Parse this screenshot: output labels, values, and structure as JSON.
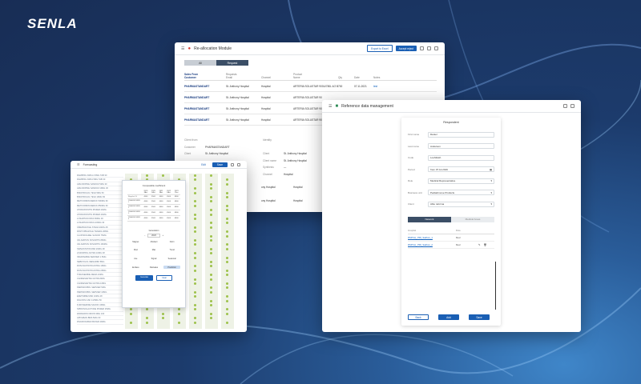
{
  "brand": {
    "logo": "SENLA"
  },
  "w1": {
    "title": "Re-allocation Module",
    "buttons": {
      "export": "Export to Excel",
      "accept": "Accept reject"
    },
    "tabs": [
      "All",
      "Request"
    ],
    "headers_top": [
      "Sales From",
      "Requests",
      "",
      "Product",
      "",
      "",
      ""
    ],
    "headers": [
      "Customer",
      "Email",
      "Channel",
      "Name",
      "Qty",
      "Date",
      "Notes"
    ],
    "rows": [
      [
        "PHARMASTANDART",
        "St. Anthony Hospital",
        "Hospital",
        "ARTERIA SOLUSTAR 900U/780L 4/2 BLOB0 WL",
        "700",
        "07.11.2021",
        "test"
      ],
      [
        "PHARMASTANDART",
        "St. Anthony Hospital",
        "Hospital",
        "ARTERIA SOLUSTAR 90",
        "",
        "",
        ""
      ],
      [
        "PHARMASTANDART",
        "St. Anthony Hospital",
        "Hospital",
        "ARTERIA SOLUSTAR 90",
        "",
        "",
        ""
      ],
      [
        "PHARMASTANDART",
        "St. Anthony Hospital",
        "Hospital",
        "ARTERIA SOLUSTAR 90",
        "",
        "",
        ""
      ]
    ],
    "detail_head": [
      "Client from",
      "Identity"
    ],
    "detail_left": [
      [
        "Customer",
        "PHARMASTANDART"
      ],
      [
        "Client",
        "St. Anthony Hospital"
      ]
    ],
    "detail_right": [
      [
        "Client",
        "St. Anthony Hospital"
      ],
      [
        "Client name",
        "St. Anthony Hospital"
      ],
      [
        "Synthesis",
        "—"
      ],
      [
        "Channel",
        "Hospital"
      ]
    ],
    "extra_rows": [
      [
        "ony Hospital",
        "Hospital",
        "ARTERIA SOLUSTAR 9"
      ],
      [
        "ony Hospital",
        "Hospital",
        "ARTERIA SOLUSTAR 9"
      ]
    ]
  },
  "w2": {
    "title": "Forecasting",
    "bar_btns": [
      "Edit",
      "Save"
    ],
    "left_items": [
      "RAMIPRIL KRKA 2.5MG TAB 30",
      "RAMIPRIL KRKA 5MG TAB 30",
      "AMLODIPINE SANDOZ 5MG 30",
      "AMLODIPINE SANDOZ 10MG 30",
      "BISOPROLOL TEVA 5MG 50",
      "BISOPROLOL TEVA 10MG 50",
      "METFORMIN MERCK 500MG 60",
      "METFORMIN MERCK 850MG 60",
      "ATORVASTATIN PFIZER 20MG",
      "ATORVASTATIN PFIZER 40MG",
      "LOSARTAN KRKA 50MG 30",
      "LOSARTAN KRKA 100MG 30",
      "OMEPRAZOLE STADA 20MG 28",
      "PANTOPRAZOLE TAKEDA 40MG",
      "CLOPIDOGREL SANOFI 75MG",
      "VALSARTAN NOVARTIS 80MG",
      "VALSARTAN NOVARTIS 160MG",
      "SIMVASTATIN MSD 20MG 28",
      "LISINOPRIL ASTRA 10MG 28",
      "INDAPAMIDE SERVIER 1.5MG",
      "NEBIVOLOL MENARINI 5MG",
      "ROSUVASTATIN ASTRA 10MG",
      "ROSUVASTATIN ASTRA 20MG",
      "TORASEMIDE MEDA 10MG",
      "CANDESARTAN ASTRA 8MG",
      "CANDESARTAN ASTRA 16MG",
      "PERINDOPRIL SERVIER 5MG",
      "PERINDOPRIL SERVIER 10MG",
      "EZETIMIBE MSD 10MG 28",
      "DIGOXIN GSK 0.25MG 50",
      "FUROSEMIDE SANOFI 40MG",
      "SPIRONOLACTONE PFIZER 25MG",
      "WARFARIN ORION 3MG 100",
      "APIXABAN BMS 5MG 60",
      "RIVAROXABAN BAYER 20MG"
    ],
    "modal": {
      "title": "Comparable coefficient",
      "col_heads": [
        "",
        "2019 FAct",
        "2020 FAct",
        "2021 FAct",
        "2022 FAct",
        "2023 Plan"
      ],
      "rows": [
        [
          "Regular LS",
          "4000",
          "3500",
          "4000",
          "4500",
          "4800"
        ],
        [
          "PHARMSTAND 1",
          "4000",
          "3500",
          "4000",
          "4500",
          "4800"
        ],
        [
          "PHARMSTAND 2",
          "4000",
          "3500",
          "4000",
          "4500",
          "4800"
        ],
        [
          "PHARMSTAND 3",
          "4000",
          "3500",
          "4000",
          "4500",
          "4800"
        ],
        [
          "PHARMSTAND 4",
          "4000",
          "3500",
          "4000",
          "4500",
          "4800"
        ]
      ],
      "generation": "Generation",
      "year": "2023",
      "options": [
        "Magnet",
        "Abstract",
        "Norm",
        "Mod",
        "Max",
        "Trend",
        "Ave",
        "Signal",
        "Seasonal",
        "Endless",
        "Flat/sales",
        "Prediction"
      ],
      "buttons": [
        "Generate",
        "Clear"
      ]
    }
  },
  "w3": {
    "title": "Reference data management",
    "form_title": "Respondent",
    "fields": [
      [
        "First name",
        "Daniel"
      ],
      [
        "Last name",
        "Anderson"
      ],
      [
        "Code",
        "Loofdrash"
      ],
      [
        "Period",
        "from 07.12.2019"
      ],
      [
        "Role",
        "Medical Representative"
      ],
      [
        "Business unit",
        "Pediatrimove Products"
      ],
      [
        "Client",
        "Able reforma"
      ]
    ],
    "tabs": [
      "Network",
      "Medical Areas"
    ],
    "table_head": [
      "Hospital",
      "Role"
    ],
    "table_rows": [
      [
        "RSPCH_ PRI_Sakhon_1",
        "Med"
      ],
      [
        "RSPCH_ PRI_Sakhon_2",
        "Med"
      ]
    ],
    "buttons": [
      "Back",
      "Add",
      "Save"
    ]
  }
}
